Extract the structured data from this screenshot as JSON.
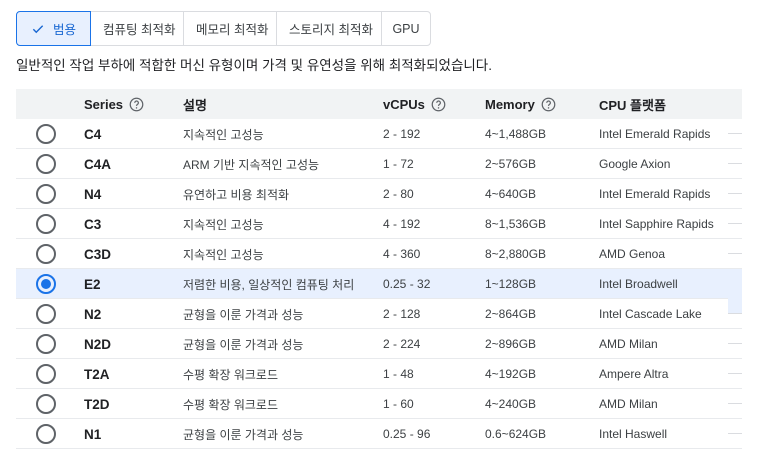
{
  "tabs": [
    {
      "label": "범용",
      "selected": true
    },
    {
      "label": "컴퓨팅 최적화",
      "selected": false
    },
    {
      "label": "메모리 최적화",
      "selected": false
    },
    {
      "label": "스토리지 최적화",
      "selected": false
    },
    {
      "label": "GPU",
      "selected": false
    }
  ],
  "description": "일반적인 작업 부하에 적합한 머신 유형이며 가격 및 유연성을 위해 최적화되었습니다.",
  "table": {
    "headers": {
      "series": "Series",
      "description": "설명",
      "vcpus": "vCPUs",
      "memory": "Memory",
      "cpu_platform": "CPU 플랫폼"
    },
    "rows": [
      {
        "series": "C4",
        "description": "지속적인 고성능",
        "vcpus": "2 - 192",
        "memory": "4~1,488GB",
        "cpu": "Intel Emerald Rapids",
        "selected": false
      },
      {
        "series": "C4A",
        "description": "ARM 기반 지속적인 고성능",
        "vcpus": "1 - 72",
        "memory": "2~576GB",
        "cpu": "Google Axion",
        "selected": false
      },
      {
        "series": "N4",
        "description": "유연하고 비용 최적화",
        "vcpus": "2 - 80",
        "memory": "4~640GB",
        "cpu": "Intel Emerald Rapids",
        "selected": false
      },
      {
        "series": "C3",
        "description": "지속적인 고성능",
        "vcpus": "4 - 192",
        "memory": "8~1,536GB",
        "cpu": "Intel Sapphire Rapids",
        "selected": false
      },
      {
        "series": "C3D",
        "description": "지속적인 고성능",
        "vcpus": "4 - 360",
        "memory": "8~2,880GB",
        "cpu": "AMD Genoa",
        "selected": false
      },
      {
        "series": "E2",
        "description": "저렴한 비용, 일상적인 컴퓨팅 처리",
        "vcpus": "0.25 - 32",
        "memory": "1~128GB",
        "cpu": "Intel Broadwell",
        "selected": true
      },
      {
        "series": "N2",
        "description": "균형을 이룬 가격과 성능",
        "vcpus": "2 - 128",
        "memory": "2~864GB",
        "cpu": "Intel Cascade Lake",
        "selected": false
      },
      {
        "series": "N2D",
        "description": "균형을 이룬 가격과 성능",
        "vcpus": "2 - 224",
        "memory": "2~896GB",
        "cpu": "AMD Milan",
        "selected": false
      },
      {
        "series": "T2A",
        "description": "수평 확장 워크로드",
        "vcpus": "1 - 48",
        "memory": "4~192GB",
        "cpu": "Ampere Altra",
        "selected": false
      },
      {
        "series": "T2D",
        "description": "수평 확장 워크로드",
        "vcpus": "1 - 60",
        "memory": "4~240GB",
        "cpu": "AMD Milan",
        "selected": false
      },
      {
        "series": "N1",
        "description": "균형을 이룬 가격과 성능",
        "vcpus": "0.25 - 96",
        "memory": "0.6~624GB",
        "cpu": "Intel Haswell",
        "selected": false
      }
    ]
  },
  "colors": {
    "accent": "#1a73e8",
    "selected_bg": "#e8f0fe",
    "header_bg": "#f1f3f4"
  }
}
